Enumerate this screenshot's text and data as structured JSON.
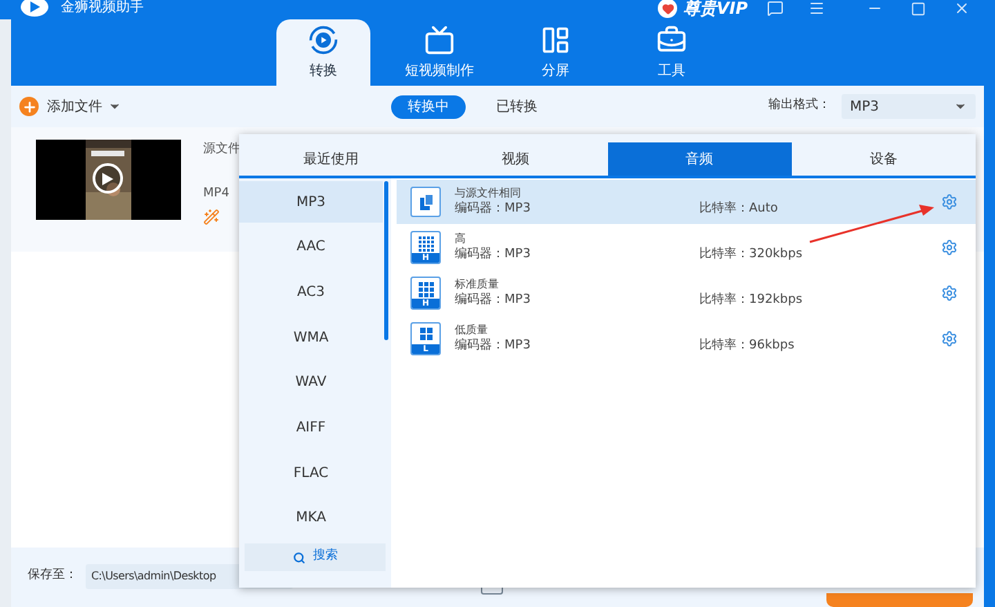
{
  "app": {
    "title": "金狮视频助手",
    "vip": "尊贵VIP"
  },
  "nav_tabs": [
    {
      "label": "转换",
      "selected": true,
      "kind": "convert"
    },
    {
      "label": "短视频制作",
      "selected": false,
      "kind": "video"
    },
    {
      "label": "分屏",
      "selected": false,
      "kind": "split"
    },
    {
      "label": "工具",
      "selected": false,
      "kind": "tools"
    }
  ],
  "toolbar": {
    "add_file": "添加文件",
    "status_tabs": [
      {
        "label": "转换中",
        "selected": true
      },
      {
        "label": "已转换",
        "selected": false
      }
    ],
    "output_format_label": "输出格式：",
    "output_format": "MP3"
  },
  "file": {
    "name": "源文件",
    "format": "MP4"
  },
  "format_popup": {
    "tabs": [
      {
        "label": "最近使用",
        "selected": false
      },
      {
        "label": "视频",
        "selected": false
      },
      {
        "label": "音频",
        "selected": true
      },
      {
        "label": "设备",
        "selected": false
      }
    ],
    "formats": [
      {
        "label": "MP3",
        "selected": true
      },
      {
        "label": "AAC",
        "selected": false
      },
      {
        "label": "AC3",
        "selected": false
      },
      {
        "label": "WMA",
        "selected": false
      },
      {
        "label": "WAV",
        "selected": false
      },
      {
        "label": "AIFF",
        "selected": false
      },
      {
        "label": "FLAC",
        "selected": false
      },
      {
        "label": "MKA",
        "selected": false
      }
    ],
    "search": "搜索",
    "presets": [
      {
        "kind": "same",
        "name": "与源文件相同",
        "codec": "编码器：MP3",
        "bitrate": "比特率：Auto",
        "selected": true
      },
      {
        "kind": "high",
        "badge": "H",
        "name": "高",
        "codec": "编码器：MP3",
        "bitrate": "比特率：320kbps",
        "selected": false
      },
      {
        "kind": "standard",
        "badge": "H",
        "name": "标准质量",
        "codec": "编码器：MP3",
        "bitrate": "比特率：192kbps",
        "selected": false
      },
      {
        "kind": "low",
        "badge": "L",
        "name": "低质量",
        "codec": "编码器：MP3",
        "bitrate": "比特率：96kbps",
        "selected": false
      }
    ]
  },
  "save": {
    "label": "保存至：",
    "path": "C:\\Users\\admin\\Desktop"
  }
}
